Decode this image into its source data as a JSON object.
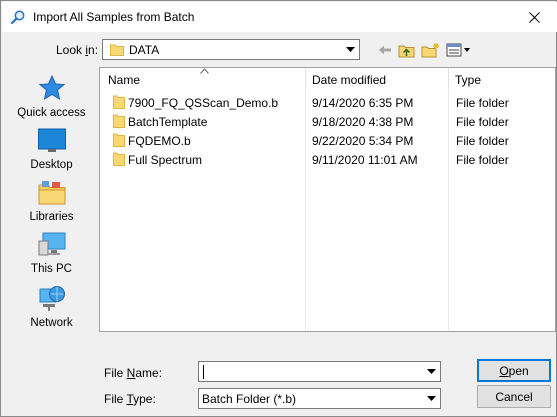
{
  "window": {
    "title": "Import All Samples from Batch"
  },
  "lookin": {
    "label_prefix": "Look ",
    "label_u": "i",
    "label_suffix": "n:",
    "value": "DATA"
  },
  "places": [
    {
      "label": "Quick access",
      "icon": "quick-access-icon"
    },
    {
      "label": "Desktop",
      "icon": "desktop-icon"
    },
    {
      "label": "Libraries",
      "icon": "libraries-icon"
    },
    {
      "label": "This PC",
      "icon": "this-pc-icon"
    },
    {
      "label": "Network",
      "icon": "network-icon"
    }
  ],
  "columns": {
    "name": "Name",
    "date": "Date modified",
    "type": "Type"
  },
  "files": [
    {
      "name": "7900_FQ_QSScan_Demo.b",
      "date": "9/14/2020 6:35 PM",
      "type": "File folder"
    },
    {
      "name": "BatchTemplate",
      "date": "9/18/2020 4:38 PM",
      "type": "File folder"
    },
    {
      "name": "FQDEMO.b",
      "date": "9/22/2020 5:34 PM",
      "type": "File folder"
    },
    {
      "name": "Full Spectrum",
      "date": "9/11/2020 11:01 AM",
      "type": "File folder"
    }
  ],
  "filename": {
    "label_prefix": "File ",
    "label_u": "N",
    "label_suffix": "ame:",
    "value": ""
  },
  "filetype": {
    "label_prefix": "File ",
    "label_u": "T",
    "label_suffix": "ype:",
    "value": "Batch Folder (*.b)"
  },
  "buttons": {
    "open_u": "O",
    "open_rest": "pen",
    "cancel": "Cancel"
  },
  "colors": {
    "folder": "#f8d775",
    "folder_dark": "#e0b548",
    "accent": "#0078d7"
  }
}
